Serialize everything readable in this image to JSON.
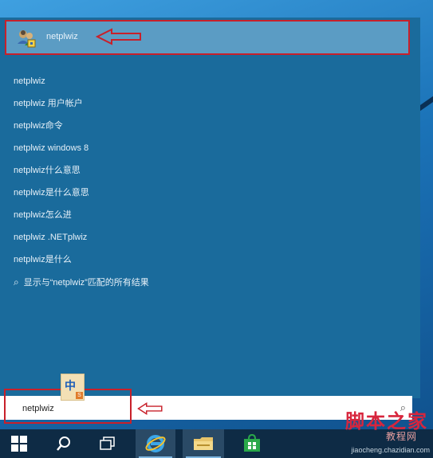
{
  "best_match": {
    "label": "netplwiz",
    "icon": "netplwiz-users-icon"
  },
  "suggestions": [
    "netplwiz",
    "netplwiz 用户帐户",
    "netplwiz命令",
    "netplwiz windows 8",
    "netplwiz什么意思",
    "netplwiz是什么意思",
    "netplwiz怎么进",
    "netplwiz .NETplwiz",
    "netplwiz是什么"
  ],
  "search_all": {
    "label": "显示与“netplwiz”匹配的所有结果",
    "icon": "search-icon"
  },
  "search_box": {
    "value": "netplwiz"
  },
  "ime": {
    "mode": "中",
    "badge": "S"
  },
  "taskbar": {
    "items": [
      "start-icon",
      "search-icon",
      "task-view-icon",
      "internet-explorer-icon",
      "file-explorer-icon",
      "store-icon"
    ]
  },
  "watermark": {
    "logo": "脚本之家",
    "sub": "教程网",
    "url": "jiaocheng.chazidian.com"
  },
  "colors": {
    "panel": "#1a6b9c",
    "highlight": "#5b9cc4",
    "annotation": "#c8202a",
    "taskbar": "#0e2b45"
  }
}
